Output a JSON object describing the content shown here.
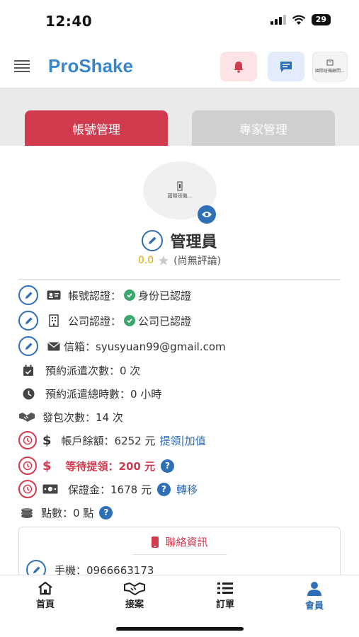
{
  "status_bar": {
    "time": "12:40",
    "battery": "29"
  },
  "header": {
    "brand": "ProShake",
    "company_label": "國際班機顧問..."
  },
  "tabs": [
    {
      "label": "帳號管理",
      "active": true
    },
    {
      "label": "專家管理",
      "active": false
    }
  ],
  "profile": {
    "avatar_label": "國際班機...",
    "name": "管理員",
    "rating": "0.0",
    "rating_note": "(尚無評論)"
  },
  "info": {
    "account_verify_label": "帳號認證：",
    "account_verify_value": "身份已認證",
    "company_verify_label": "公司認證：",
    "company_verify_value": "公司已認證",
    "email": "信箱：syusyuan99@gmail.com",
    "booking_count": "預約派遣次數：0 次",
    "booking_hours": "預約派遣總時數：0 小時",
    "outsource_count": "發包次數：14 次",
    "balance": "帳戶餘額：6252 元",
    "withdraw_link": "提領",
    "separator": "|",
    "topup_link": "加值",
    "pending": "等待提領：200 元",
    "deposit": "保證金：1678 元",
    "transfer_link": "轉移",
    "points": "點數：0 點",
    "help_symbol": "?"
  },
  "contact": {
    "title": "聯絡資訊",
    "phone": "手機：0966663173"
  },
  "bottom_nav": [
    {
      "label": "首頁",
      "icon": "home-icon",
      "active": false
    },
    {
      "label": "接案",
      "icon": "handshake-icon",
      "active": false
    },
    {
      "label": "訂單",
      "icon": "list-icon",
      "active": false
    },
    {
      "label": "會員",
      "icon": "user-icon",
      "active": true
    }
  ],
  "colors": {
    "brand": "#3a86c8",
    "accent_red": "#d23a4e",
    "link_blue": "#2f6fb8",
    "verified_green": "#3aa76d",
    "star": "#e0a600"
  }
}
